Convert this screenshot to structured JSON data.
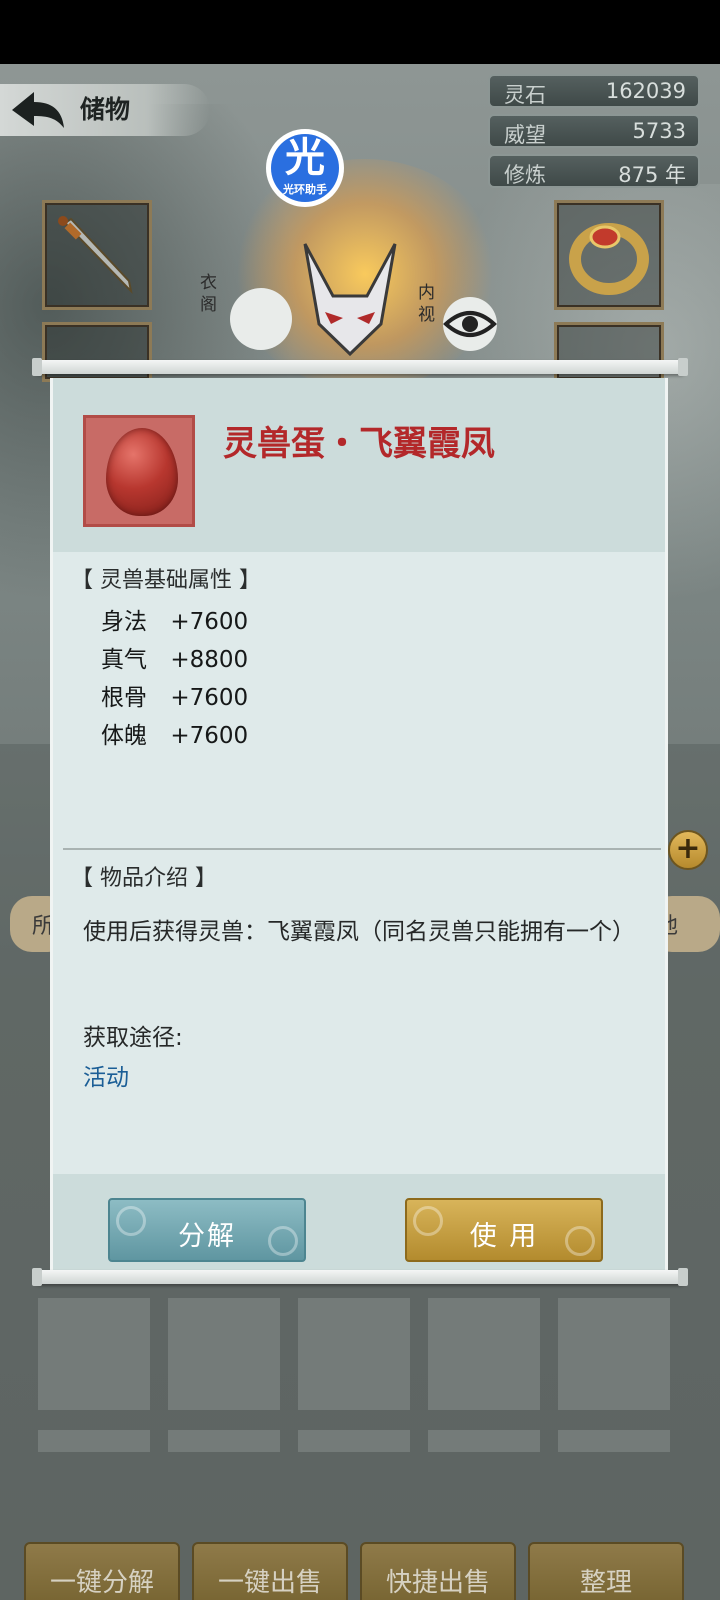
{
  "header": {
    "back_label": "储物"
  },
  "helper_badge": {
    "glyph": "光",
    "label": "光环助手"
  },
  "stats": [
    {
      "label": "灵石",
      "value": "162039"
    },
    {
      "label": "威望",
      "value": "5733"
    },
    {
      "label": "修炼",
      "value": "875 年"
    }
  ],
  "background_labels": {
    "left_glyph": "衣阁",
    "right_glyph": "内视",
    "tab_left": "所",
    "tab_right": "他"
  },
  "dialog": {
    "item_name": "灵兽蛋・飞翼霞凤",
    "attributes_title": "【 灵兽基础属性 】",
    "attributes": [
      {
        "label": "身法",
        "value": "+7600"
      },
      {
        "label": "真气",
        "value": "+8800"
      },
      {
        "label": "根骨",
        "value": "+7600"
      },
      {
        "label": "体魄",
        "value": "+7600"
      }
    ],
    "intro_title": "【 物品介绍 】",
    "description": "使用后获得灵兽：飞翼霞凤（同名灵兽只能拥有一个）",
    "source_label": "获取途径:",
    "source_value": "活动",
    "buttons": {
      "decompose": "分解",
      "use": "使 用"
    }
  },
  "bottom_bar": {
    "buttons": [
      "一键分解",
      "一键出售",
      "快捷出售",
      "整理"
    ]
  },
  "colors": {
    "item_name": "#b3282a",
    "source_link": "#1b5e96",
    "use_button": "#c9a040",
    "decompose_button": "#77a9b2"
  }
}
